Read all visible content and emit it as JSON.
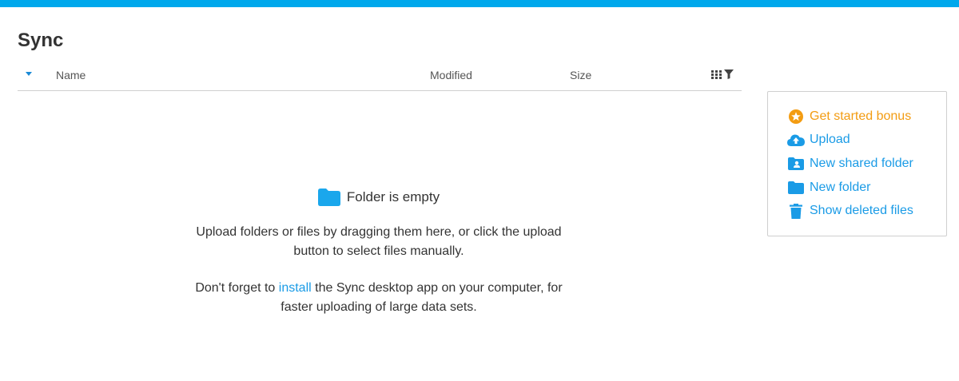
{
  "app": {
    "title": "Sync"
  },
  "colors": {
    "accent": "#00a8ec",
    "link": "#1a9be6",
    "bonus": "#f39c12",
    "folder": "#1aa7ec"
  },
  "file_table": {
    "columns": {
      "name": "Name",
      "modified": "Modified",
      "size": "Size"
    },
    "tools": [
      "grid-view-icon",
      "filter-icon"
    ]
  },
  "empty_state": {
    "title": "Folder is empty",
    "line1": "Upload folders or files by dragging them here, or click the upload button to select files manually.",
    "line2_pre": "Don't forget to ",
    "line2_link": "install",
    "line2_post": " the Sync desktop app on your computer, for faster uploading of large data sets."
  },
  "actions": {
    "bonus": "Get started bonus",
    "upload": "Upload",
    "new_shared_folder": "New shared folder",
    "new_folder": "New folder",
    "show_deleted": "Show deleted files"
  }
}
